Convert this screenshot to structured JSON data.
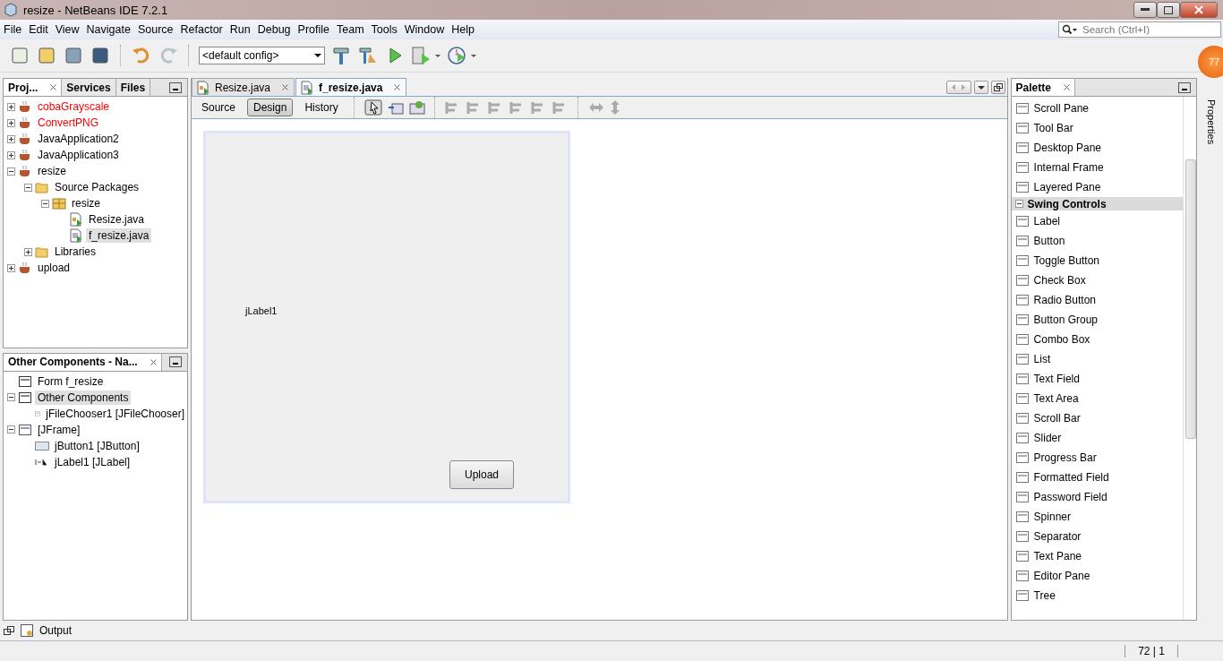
{
  "window": {
    "title": "resize - NetBeans IDE 7.2.1"
  },
  "menu": [
    "File",
    "Edit",
    "View",
    "Navigate",
    "Source",
    "Refactor",
    "Run",
    "Debug",
    "Profile",
    "Team",
    "Tools",
    "Window",
    "Help"
  ],
  "search": {
    "placeholder": "Search (Ctrl+I)"
  },
  "toolbar": {
    "config": "<default config>"
  },
  "projects": {
    "tabs": [
      {
        "label": "Proj...",
        "selected": true
      },
      {
        "label": "Services",
        "selected": false
      },
      {
        "label": "Files",
        "selected": false
      }
    ],
    "tree": [
      {
        "label": "cobaGrayscale",
        "kind": "project",
        "warning": true,
        "expanded": false,
        "selected": false
      },
      {
        "label": "ConvertPNG",
        "kind": "project",
        "warning": true,
        "expanded": false,
        "selected": false
      },
      {
        "label": "JavaApplication2",
        "kind": "project",
        "warning": false,
        "expanded": false,
        "selected": false
      },
      {
        "label": "JavaApplication3",
        "kind": "project",
        "warning": false,
        "expanded": false,
        "selected": false
      },
      {
        "label": "resize",
        "kind": "project",
        "warning": false,
        "expanded": true,
        "selected": false,
        "children": [
          {
            "label": "Source Packages",
            "kind": "folder",
            "warning": false,
            "expanded": true,
            "selected": false,
            "children": [
              {
                "label": "resize",
                "kind": "package",
                "warning": false,
                "expanded": true,
                "selected": false,
                "children": [
                  {
                    "label": "Resize.java",
                    "kind": "java",
                    "warning": false,
                    "selected": false
                  },
                  {
                    "label": "f_resize.java",
                    "kind": "form",
                    "warning": false,
                    "selected": true
                  }
                ]
              }
            ]
          },
          {
            "label": "Libraries",
            "kind": "folder",
            "warning": false,
            "expanded": false,
            "selected": false
          }
        ]
      },
      {
        "label": "upload",
        "kind": "project",
        "warning": false,
        "expanded": false,
        "selected": false
      }
    ]
  },
  "navigator": {
    "title": "Other Components - Na...",
    "tree": [
      {
        "label": "Form f_resize",
        "kind": "formroot",
        "warning": false,
        "selected": false
      },
      {
        "label": "Other Components",
        "kind": "group",
        "warning": false,
        "expanded": true,
        "selected": true,
        "children": [
          {
            "label": "jFileChooser1 [JFileChooser]",
            "kind": "chooser",
            "warning": false,
            "selected": false
          }
        ]
      },
      {
        "label": "[JFrame]",
        "kind": "frame",
        "warning": false,
        "expanded": true,
        "selected": false,
        "children": [
          {
            "label": "jButton1 [JButton]",
            "kind": "button",
            "warning": false,
            "selected": false
          },
          {
            "label": "jLabel1 [JLabel]",
            "kind": "label",
            "warning": false,
            "selected": false
          }
        ]
      }
    ]
  },
  "editor": {
    "tabs": [
      {
        "label": "Resize.java",
        "kind": "java",
        "selected": false
      },
      {
        "label": "f_resize.java",
        "kind": "form",
        "selected": true
      }
    ],
    "views": [
      {
        "label": "Source",
        "selected": false
      },
      {
        "label": "Design",
        "selected": true
      },
      {
        "label": "History",
        "selected": false
      }
    ],
    "form": {
      "label": "jLabel1",
      "button": "Upload"
    }
  },
  "palette": {
    "title": "Palette",
    "items": [
      {
        "label": "Scroll Pane",
        "kind": "item"
      },
      {
        "label": "Tool Bar",
        "kind": "item"
      },
      {
        "label": "Desktop Pane",
        "kind": "item"
      },
      {
        "label": "Internal Frame",
        "kind": "item"
      },
      {
        "label": "Layered Pane",
        "kind": "item"
      },
      {
        "label": "Swing Controls",
        "kind": "category",
        "expanded": true
      },
      {
        "label": "Label",
        "kind": "item"
      },
      {
        "label": "Button",
        "kind": "item"
      },
      {
        "label": "Toggle Button",
        "kind": "item"
      },
      {
        "label": "Check Box",
        "kind": "item"
      },
      {
        "label": "Radio Button",
        "kind": "item"
      },
      {
        "label": "Button Group",
        "kind": "item"
      },
      {
        "label": "Combo Box",
        "kind": "item"
      },
      {
        "label": "List",
        "kind": "item"
      },
      {
        "label": "Text Field",
        "kind": "item"
      },
      {
        "label": "Text Area",
        "kind": "item"
      },
      {
        "label": "Scroll Bar",
        "kind": "item"
      },
      {
        "label": "Slider",
        "kind": "item"
      },
      {
        "label": "Progress Bar",
        "kind": "item"
      },
      {
        "label": "Formatted Field",
        "kind": "item"
      },
      {
        "label": "Password Field",
        "kind": "item"
      },
      {
        "label": "Spinner",
        "kind": "item"
      },
      {
        "label": "Separator",
        "kind": "item"
      },
      {
        "label": "Text Pane",
        "kind": "item"
      },
      {
        "label": "Editor Pane",
        "kind": "item"
      },
      {
        "label": "Tree",
        "kind": "item"
      }
    ]
  },
  "side": {
    "properties": "Properties",
    "badge": "77"
  },
  "output": {
    "label": "Output"
  },
  "status": {
    "position": "72 | 1"
  }
}
